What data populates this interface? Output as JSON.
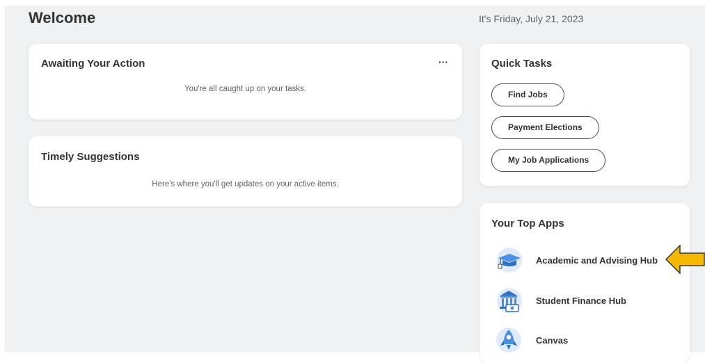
{
  "header": {
    "title": "Welcome",
    "date": "It's Friday, July 21, 2023"
  },
  "awaiting": {
    "title": "Awaiting Your Action",
    "more": "···",
    "message": "You're all caught up on your tasks."
  },
  "suggestions": {
    "title": "Timely Suggestions",
    "message": "Here's where you'll get updates on your active items."
  },
  "quick_tasks": {
    "title": "Quick Tasks",
    "buttons": [
      "Find Jobs",
      "Payment Elections",
      "My Job Applications"
    ]
  },
  "top_apps": {
    "title": "Your Top Apps",
    "apps": [
      {
        "label": "Academic and Advising Hub",
        "icon": "graduation-cap-icon"
      },
      {
        "label": "Student Finance Hub",
        "icon": "bank-building-icon"
      },
      {
        "label": "Canvas",
        "icon": "rocket-icon"
      }
    ]
  },
  "annotation": {
    "arrow_color": "#f5b800",
    "arrow_points_to": "Academic and Advising Hub"
  },
  "colors": {
    "background": "#f0f1f2",
    "card": "#ffffff",
    "text_primary": "#333333",
    "text_secondary": "#5e6266",
    "icon_blue": "#4a8fe0"
  }
}
